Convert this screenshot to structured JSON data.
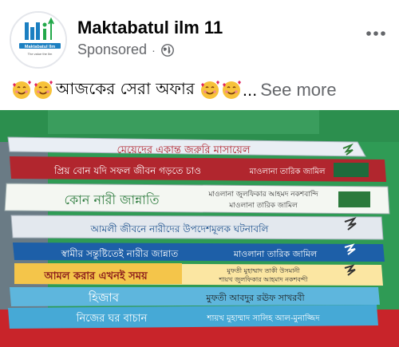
{
  "post": {
    "page_name": "Maktabatul ilm 11",
    "sponsored_label": "Sponsored",
    "separator": "·",
    "caption_text": "আজকের সেরা অফার",
    "ellipsis": "...",
    "see_more_label": "See more",
    "icons": {
      "avatar": "maktabatul-logo",
      "audience": "globe-icon",
      "menu": "more-options-icon",
      "emoji": "smiling-face-with-hearts"
    }
  },
  "logo": {
    "mark": "MI",
    "text": "Maktabatul Ilm",
    "tagline": "The value the Ilm"
  },
  "books": [
    {
      "title": "মেয়েদের একান্ত জরুরি মাসায়েল",
      "author": ""
    },
    {
      "title": "প্রিয় বোন যদি সফল জীবন গড়তে চাও",
      "author": "মাওলানা তারিক জামিল"
    },
    {
      "title": "কোন নারী জান্নাতি",
      "author": "মাওলানা জুলফিকার আহমদ নকশবান্দি",
      "author2": "মাওলানা তারিক জামিল"
    },
    {
      "title": "আমলী জীবনে নারীদের উপদেশমূলক ঘটনাবলি",
      "author": ""
    },
    {
      "title": "স্বামীর সন্তুষ্টিতেই নারীর জান্নাত",
      "author": "মাওলানা তারিক জামিল"
    },
    {
      "title": "আমল করার এখনই সময়",
      "author": "মুফতী মুহাম্মাদ তাকী উসমানী",
      "author2": "শায়খ জুলফিকার আহমাদ নকশবন্দী"
    },
    {
      "title": "হিজাব",
      "author": "মুফতী আবদুর রঊফ সাখরবী"
    },
    {
      "title": "নিজের ঘর বাচান",
      "author": "শায়খ মুহাম্মাদ সালিহ আল-মুনাজ্জিদ"
    }
  ],
  "colors": {
    "text_primary": "#050505",
    "text_secondary": "#65676b",
    "wall_green": "#2f9b55",
    "table_red": "#c8242a"
  }
}
